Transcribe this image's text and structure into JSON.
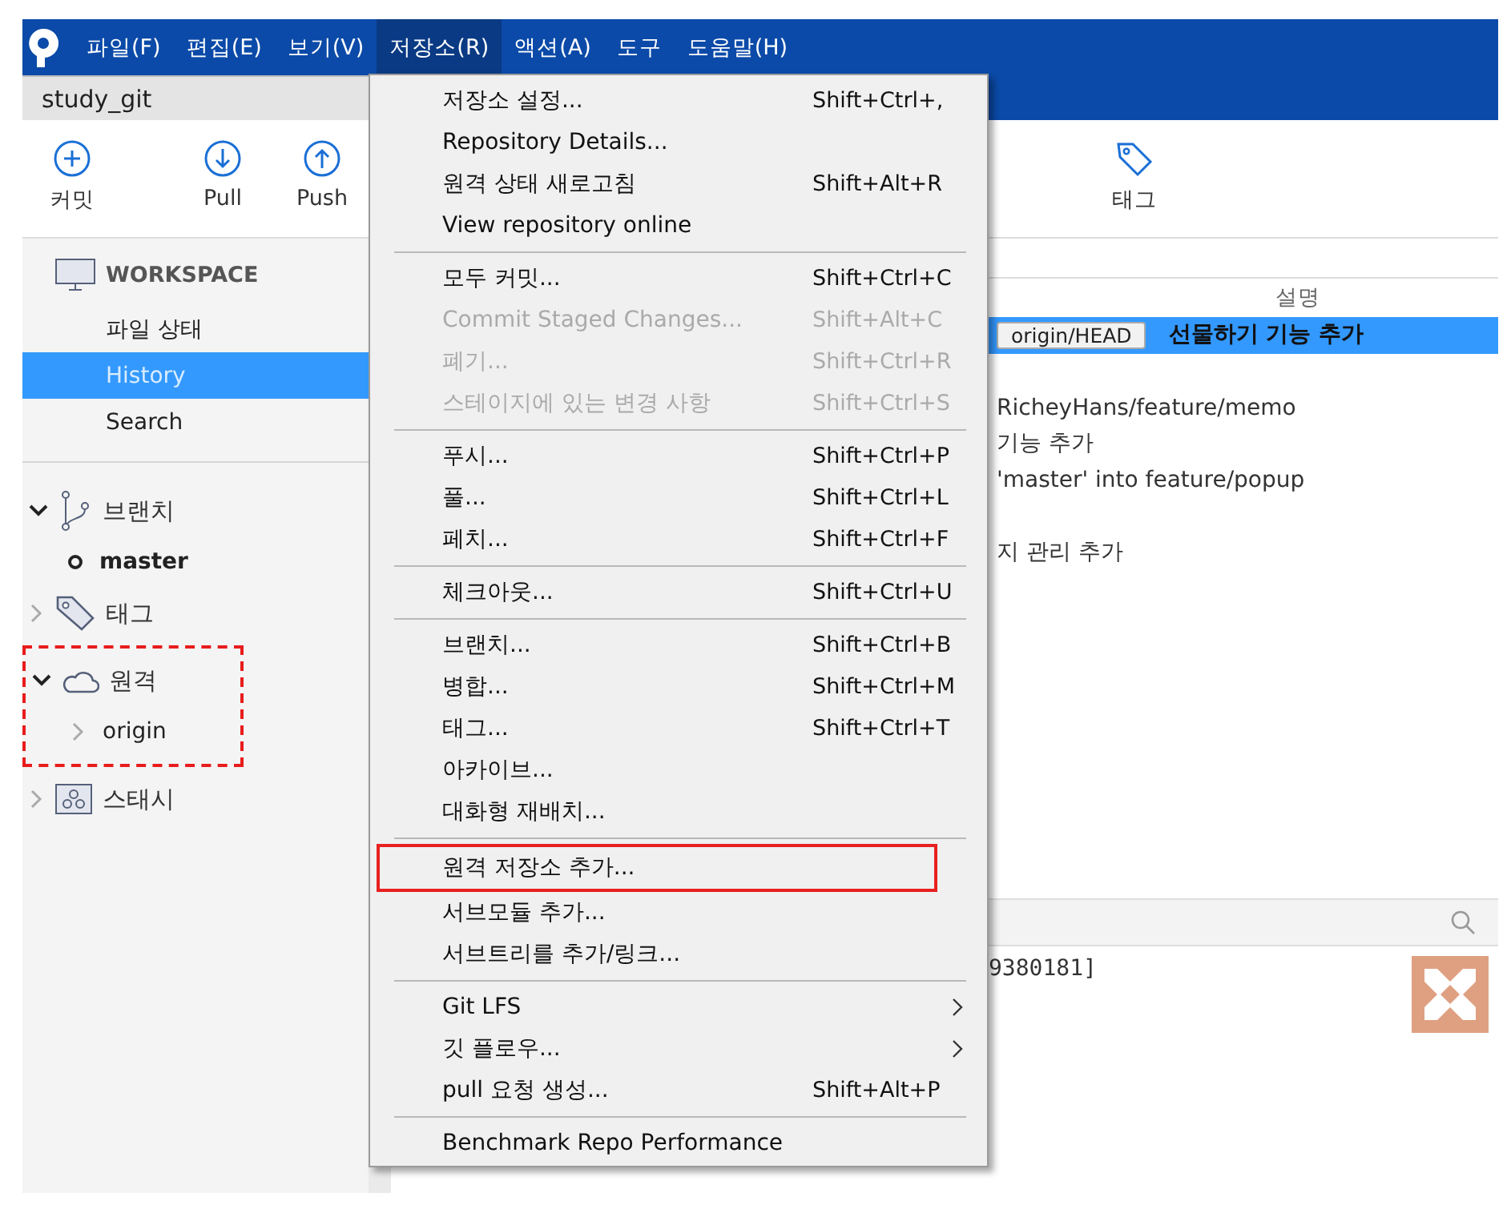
{
  "menubar": [
    {
      "label": "파일(F)",
      "selected": false
    },
    {
      "label": "편집(E)",
      "selected": false
    },
    {
      "label": "보기(V)",
      "selected": false
    },
    {
      "label": "저장소(R)",
      "selected": true
    },
    {
      "label": "액션(A)",
      "selected": false
    },
    {
      "label": "도구",
      "selected": false
    },
    {
      "label": "도움말(H)",
      "selected": false
    }
  ],
  "tab": {
    "title": "study_git"
  },
  "toolbar": [
    {
      "label": "커밋",
      "kind": "plus"
    },
    {
      "label": "Pull",
      "kind": "down"
    },
    {
      "label": "Push",
      "kind": "up"
    },
    {
      "label": "태그",
      "kind": "tag"
    }
  ],
  "sidebar": {
    "workspace": "WORKSPACE",
    "items": [
      {
        "label": "파일 상태",
        "selected": false
      },
      {
        "label": "History",
        "selected": true
      },
      {
        "label": "Search",
        "selected": false
      }
    ],
    "groups": [
      {
        "label": "브랜치",
        "kind": "branch",
        "expanded": true,
        "highlighted": false,
        "children": [
          {
            "label": "master",
            "current": true
          }
        ]
      },
      {
        "label": "태그",
        "kind": "tag",
        "expanded": false,
        "highlighted": false
      },
      {
        "label": "원격",
        "kind": "cloud",
        "expanded": true,
        "highlighted": true,
        "children": [
          {
            "label": "origin",
            "current": false
          }
        ]
      },
      {
        "label": "스태시",
        "kind": "stash",
        "expanded": false,
        "highlighted": false
      }
    ]
  },
  "commits": {
    "column": "설명",
    "rows": [
      {
        "kind": "commit",
        "ref": "origin/HEAD",
        "text": "선물하기 기능 추가",
        "selected": true
      },
      {
        "kind": "empty"
      },
      {
        "kind": "commit",
        "text": "RicheyHans/feature/memo",
        "selected": false
      },
      {
        "kind": "commit",
        "text": "기능 추가",
        "selected": false
      },
      {
        "kind": "commit",
        "text": "'master' into feature/popup",
        "selected": false
      },
      {
        "kind": "empty"
      },
      {
        "kind": "commit",
        "text": "지 관리 추가",
        "selected": false
      }
    ]
  },
  "details": {
    "text": "9380181]"
  },
  "menu": [
    {
      "kind": "item",
      "label": "저장소 설정...",
      "shortcut": "Shift+Ctrl+,",
      "disabled": false
    },
    {
      "kind": "item",
      "label": "Repository Details...",
      "disabled": false
    },
    {
      "kind": "item",
      "label": "원격 상태 새로고침",
      "shortcut": "Shift+Alt+R",
      "disabled": false
    },
    {
      "kind": "item",
      "label": "View repository online",
      "disabled": false
    },
    {
      "kind": "separator"
    },
    {
      "kind": "item",
      "label": "모두 커밋...",
      "shortcut": "Shift+Ctrl+C",
      "disabled": false
    },
    {
      "kind": "item",
      "label": "Commit Staged Changes...",
      "shortcut": "Shift+Alt+C",
      "disabled": true
    },
    {
      "kind": "item",
      "label": "폐기...",
      "shortcut": "Shift+Ctrl+R",
      "disabled": true
    },
    {
      "kind": "item",
      "label": "스테이지에 있는 변경 사항",
      "shortcut": "Shift+Ctrl+S",
      "disabled": true
    },
    {
      "kind": "separator"
    },
    {
      "kind": "item",
      "label": "푸시...",
      "shortcut": "Shift+Ctrl+P",
      "disabled": false
    },
    {
      "kind": "item",
      "label": "풀...",
      "shortcut": "Shift+Ctrl+L",
      "disabled": false
    },
    {
      "kind": "item",
      "label": "페치...",
      "shortcut": "Shift+Ctrl+F",
      "disabled": false
    },
    {
      "kind": "separator"
    },
    {
      "kind": "item",
      "label": "체크아웃...",
      "shortcut": "Shift+Ctrl+U",
      "disabled": false
    },
    {
      "kind": "separator"
    },
    {
      "kind": "item",
      "label": "브랜치...",
      "shortcut": "Shift+Ctrl+B",
      "disabled": false
    },
    {
      "kind": "item",
      "label": "병합...",
      "shortcut": "Shift+Ctrl+M",
      "disabled": false
    },
    {
      "kind": "item",
      "label": "태그...",
      "shortcut": "Shift+Ctrl+T",
      "disabled": false
    },
    {
      "kind": "item",
      "label": "아카이브...",
      "disabled": false
    },
    {
      "kind": "item",
      "label": "대화형 재배치...",
      "disabled": false
    },
    {
      "kind": "separator"
    },
    {
      "kind": "item",
      "label": "원격 저장소 추가...",
      "disabled": false,
      "highlighted": true
    },
    {
      "kind": "item",
      "label": "서브모듈 추가...",
      "disabled": false
    },
    {
      "kind": "item",
      "label": "서브트리를 추가/링크...",
      "disabled": false
    },
    {
      "kind": "separator"
    },
    {
      "kind": "item",
      "label": "Git LFS",
      "disabled": false,
      "submenu": true
    },
    {
      "kind": "item",
      "label": "깃 플로우...",
      "disabled": false,
      "submenu": true
    },
    {
      "kind": "item",
      "label": "pull 요청 생성...",
      "shortcut": "Shift+Alt+P",
      "disabled": false
    },
    {
      "kind": "separator"
    },
    {
      "kind": "item",
      "label": "Benchmark Repo Performance",
      "disabled": false
    }
  ]
}
